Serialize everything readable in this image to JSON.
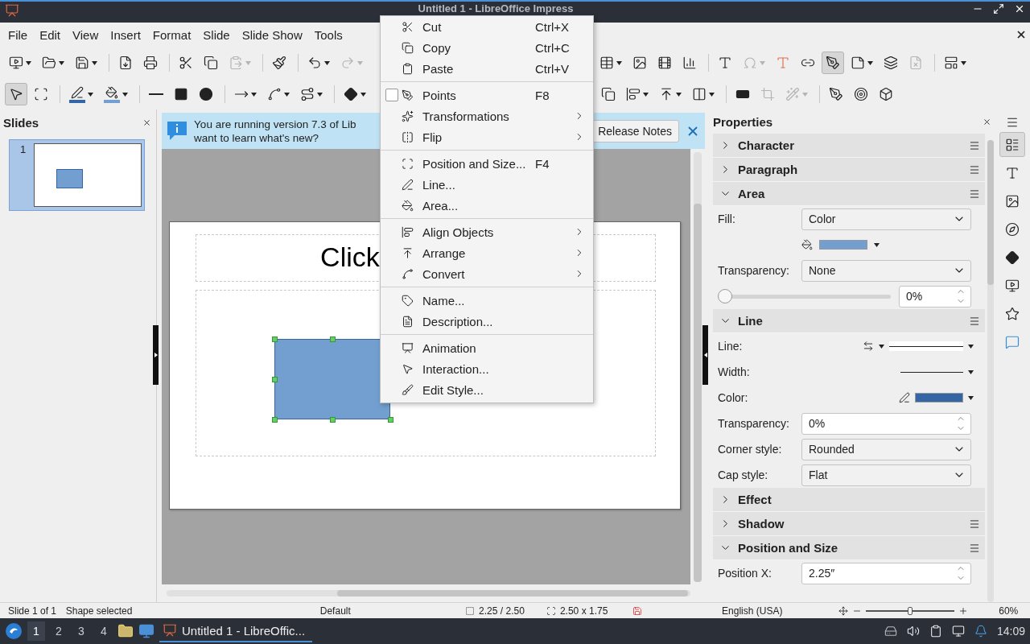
{
  "window": {
    "title": "Untitled 1 - LibreOffice Impress"
  },
  "menu_bar": [
    "File",
    "Edit",
    "View",
    "Insert",
    "Format",
    "Slide",
    "Slide Show",
    "Tools"
  ],
  "standard_toolbar": {
    "left": [
      [
        {
          "dropdown": true,
          "disabled": false,
          "active": false
        },
        {
          "dropdown": true,
          "disabled": false,
          "active": false
        },
        {
          "dropdown": true,
          "disabled": false,
          "active": false
        }
      ],
      [
        {
          "dropdown": false,
          "disabled": false,
          "active": false
        },
        {
          "dropdown": false,
          "disabled": false,
          "active": false
        }
      ],
      [
        {
          "dropdown": false,
          "disabled": false,
          "active": false
        },
        {
          "dropdown": false,
          "disabled": false,
          "active": false
        },
        {
          "dropdown": true,
          "disabled": true,
          "active": false
        }
      ],
      [
        {
          "dropdown": false,
          "disabled": false,
          "active": false
        }
      ],
      [
        {
          "dropdown": true,
          "disabled": false,
          "active": false
        },
        {
          "dropdown": true,
          "disabled": true,
          "active": false
        }
      ]
    ],
    "right": [
      [
        {
          "dropdown": true,
          "disabled": false,
          "active": false
        },
        {
          "dropdown": false,
          "disabled": false,
          "active": false
        },
        {
          "dropdown": false,
          "disabled": false,
          "active": false
        },
        {
          "dropdown": false,
          "disabled": false,
          "active": false
        }
      ],
      [
        {
          "dropdown": false,
          "disabled": false,
          "active": false
        },
        {
          "dropdown": true,
          "disabled": true,
          "active": false
        },
        {
          "dropdown": false,
          "disabled": false,
          "active": false
        },
        {
          "dropdown": false,
          "disabled": false,
          "active": false
        },
        {
          "dropdown": false,
          "disabled": false,
          "active": true
        },
        {
          "dropdown": true,
          "disabled": false,
          "active": false
        },
        {
          "dropdown": false,
          "disabled": false,
          "active": false
        },
        {
          "dropdown": false,
          "disabled": true,
          "active": false
        }
      ],
      [
        {
          "dropdown": true,
          "disabled": false,
          "active": false
        }
      ]
    ]
  },
  "drawing_toolbar": {
    "left": [
      [
        {
          "dropdown": false,
          "disabled": false,
          "active": true
        },
        {
          "dropdown": false,
          "disabled": false,
          "active": false
        }
      ],
      [
        {
          "dropdown": true,
          "disabled": false,
          "active": false
        },
        {
          "dropdown": true,
          "disabled": false,
          "active": false
        }
      ],
      [
        {
          "dropdown": false,
          "disabled": false,
          "active": false
        },
        {
          "dropdown": false,
          "disabled": false,
          "active": false
        },
        {
          "dropdown": false,
          "disabled": false,
          "active": false
        }
      ],
      [
        {
          "dropdown": true,
          "disabled": false,
          "active": false
        },
        {
          "dropdown": true,
          "disabled": false,
          "active": false
        },
        {
          "dropdown": true,
          "disabled": false,
          "active": false
        }
      ],
      [
        {
          "dropdown": true,
          "disabled": false,
          "active": false
        }
      ]
    ],
    "right": [
      [
        {
          "dropdown": false,
          "disabled": false,
          "active": false
        },
        {
          "dropdown": true,
          "disabled": false,
          "active": false
        },
        {
          "dropdown": true,
          "disabled": false,
          "active": false
        },
        {
          "dropdown": true,
          "disabled": false,
          "active": false
        }
      ],
      [
        {
          "dropdown": false,
          "disabled": false,
          "active": false
        },
        {
          "dropdown": false,
          "disabled": true,
          "active": false
        },
        {
          "dropdown": true,
          "disabled": true,
          "active": false
        }
      ],
      [
        {
          "dropdown": false,
          "disabled": false,
          "active": false
        },
        {
          "dropdown": false,
          "disabled": false,
          "active": false
        },
        {
          "dropdown": false,
          "disabled": false,
          "active": false
        }
      ]
    ]
  },
  "slides_panel": {
    "title": "Slides",
    "slides": [
      {
        "number": "1",
        "selected": true
      }
    ]
  },
  "info_bar": {
    "message_lines": [
      "You are running version 7.3 of Lib",
      "want to learn what's new?"
    ],
    "button": "Release Notes"
  },
  "slide": {
    "title_placeholder": "Click",
    "shape_selected": true
  },
  "context_menu": [
    [
      {
        "label": "Cut",
        "shortcut": "Ctrl+X",
        "submenu": false
      },
      {
        "label": "Copy",
        "shortcut": "Ctrl+C",
        "submenu": false
      },
      {
        "label": "Paste",
        "shortcut": "Ctrl+V",
        "submenu": false
      }
    ],
    [
      {
        "label": "Points",
        "shortcut": "F8",
        "submenu": false,
        "checked": false
      },
      {
        "label": "Transformations",
        "submenu": true
      },
      {
        "label": "Flip",
        "submenu": true
      }
    ],
    [
      {
        "label": "Position and Size...",
        "shortcut": "F4",
        "submenu": false
      },
      {
        "label": "Line...",
        "submenu": false
      },
      {
        "label": "Area...",
        "submenu": false
      }
    ],
    [
      {
        "label": "Align Objects",
        "submenu": true
      },
      {
        "label": "Arrange",
        "submenu": true
      },
      {
        "label": "Convert",
        "submenu": true
      }
    ],
    [
      {
        "label": "Name...",
        "submenu": false
      },
      {
        "label": "Description...",
        "submenu": false
      }
    ],
    [
      {
        "label": "Animation",
        "submenu": false
      },
      {
        "label": "Interaction...",
        "submenu": false
      },
      {
        "label": "Edit Style...",
        "submenu": false
      }
    ]
  ],
  "sidebar": {
    "title": "Properties",
    "sections": [
      {
        "title": "Character",
        "expanded": false,
        "has_menu": true
      },
      {
        "title": "Paragraph",
        "expanded": false,
        "has_menu": true
      },
      {
        "title": "Area",
        "expanded": true,
        "has_menu": true,
        "fields": [
          {
            "kind": "dropdown",
            "label": "Fill:",
            "value": "Color"
          },
          {
            "kind": "swatch",
            "color": "#729fcf"
          },
          {
            "kind": "dropdown",
            "label": "Transparency:",
            "value": "None"
          },
          {
            "kind": "slider",
            "level": 0,
            "value": "0%"
          }
        ]
      },
      {
        "title": "Line",
        "expanded": true,
        "has_menu": true,
        "fields": [
          {
            "kind": "line_style",
            "label": "Line:"
          },
          {
            "kind": "line_width",
            "label": "Width:"
          },
          {
            "kind": "line_color",
            "label": "Color:",
            "color": "#3465a4"
          },
          {
            "kind": "spin",
            "label": "Transparency:",
            "value": "0%"
          },
          {
            "kind": "dropdown",
            "label": "Corner style:",
            "value": "Rounded"
          },
          {
            "kind": "dropdown",
            "label": "Cap style:",
            "value": "Flat"
          }
        ]
      },
      {
        "title": "Effect",
        "expanded": false,
        "has_menu": false
      },
      {
        "title": "Shadow",
        "expanded": false,
        "has_menu": true
      },
      {
        "title": "Position and Size",
        "expanded": true,
        "has_menu": true,
        "fields": [
          {
            "kind": "spin",
            "label": "Position X:",
            "value": "2.25″"
          }
        ]
      }
    ],
    "tabs": [
      {
        "selected": true
      },
      {
        "selected": false
      },
      {
        "selected": false
      },
      {
        "selected": false
      },
      {
        "selected": false
      },
      {
        "selected": false
      },
      {
        "selected": false
      },
      {
        "selected": false
      }
    ]
  },
  "status_bar": {
    "slide": "Slide 1 of 1",
    "selection": "Shape selected",
    "layout": "Default",
    "position": "2.25 / 2.50",
    "size": "2.50 x 1.75",
    "language": "English (USA)",
    "zoom_slider": {
      "level": 0.5
    },
    "zoom": "60%"
  },
  "taskbar": {
    "workspaces": [
      {
        "label": "1",
        "selected": true
      },
      {
        "label": "2",
        "selected": false
      },
      {
        "label": "3",
        "selected": false
      },
      {
        "label": "4",
        "selected": false
      }
    ],
    "task": "Untitled 1 - LibreOffic...",
    "clock": "14:09"
  }
}
